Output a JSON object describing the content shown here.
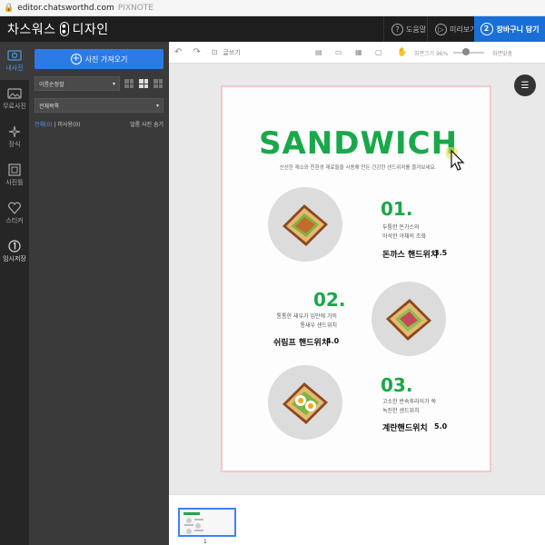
{
  "browser": {
    "url_host": "editor.chatsworthd.com",
    "url_app": "PIXNOTE"
  },
  "header": {
    "brand_left": "차스워스",
    "brand_right": "디자인",
    "help_label": "도움말",
    "preview_label": "미리보기",
    "cart_label": "장바구니 담기",
    "cart_step": "2"
  },
  "rail": {
    "items": [
      {
        "label": "내사진"
      },
      {
        "label": "무료사진"
      },
      {
        "label": "장식"
      },
      {
        "label": "사진틀"
      },
      {
        "label": "스티커"
      },
      {
        "label": "임시저장"
      }
    ]
  },
  "panel": {
    "import_label": "사진 가져오기",
    "sort_label": "이름순정렬",
    "folder_label": "전체목록",
    "filter_all": "전체(0)",
    "filter_unused": "| 미사용(0)",
    "hide_used": "얼룸 사진 숨기"
  },
  "toolbar": {
    "text_tool": "글쓰기",
    "zoom_label": "화면크기 96%",
    "fit_label": "화면맞춤"
  },
  "design": {
    "title": "SANDWICH",
    "subtitle": "신선한 재소와 친환경 재료들을 사용해 만든 건강한 샌드위치를 즐겨보세요.",
    "items": [
      {
        "number": "01.",
        "desc1": "두툼한 돈가스와",
        "desc2": "아삭한 야채의 조화",
        "name": "돈까스 핸드위치",
        "price": "3.5"
      },
      {
        "number": "02.",
        "desc1": "통통한 새우가 입안에 가득",
        "desc2": "통새우 샌드위치",
        "name": "쉬림프 핸드위치",
        "price": "4.0"
      },
      {
        "number": "03.",
        "desc1": "고소한 반숙후라이가 쏙",
        "desc2": "녹진한 샌드위치",
        "name": "계란핸드위치",
        "price": "5.0"
      }
    ]
  },
  "thumbs": {
    "page_number": "1"
  },
  "colors": {
    "accent": "#1aa84a",
    "brand_blue": "#1a6fd6"
  }
}
